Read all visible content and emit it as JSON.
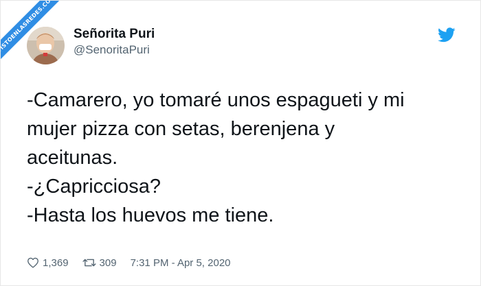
{
  "watermark": {
    "text": "VISTOENLASREDES.COM"
  },
  "tweet": {
    "display_name": "Señorita Puri",
    "handle": "@SenoritaPuri",
    "text_lines": [
      "-Camarero, yo tomaré unos espagueti y mi",
      "mujer pizza con setas, berenjena y",
      "aceitunas.",
      "-¿Capricciosa?",
      "-Hasta los huevos me tiene."
    ],
    "likes": "1,369",
    "retweets": "309",
    "timestamp": "7:31 PM - Apr 5, 2020"
  },
  "colors": {
    "twitter_blue": "#1da1f2",
    "ribbon_blue": "#2f8de4",
    "secondary_text": "#536471"
  },
  "icons": {
    "brand": "twitter-bird-icon",
    "like": "heart-icon",
    "retweet": "retweet-icon"
  }
}
